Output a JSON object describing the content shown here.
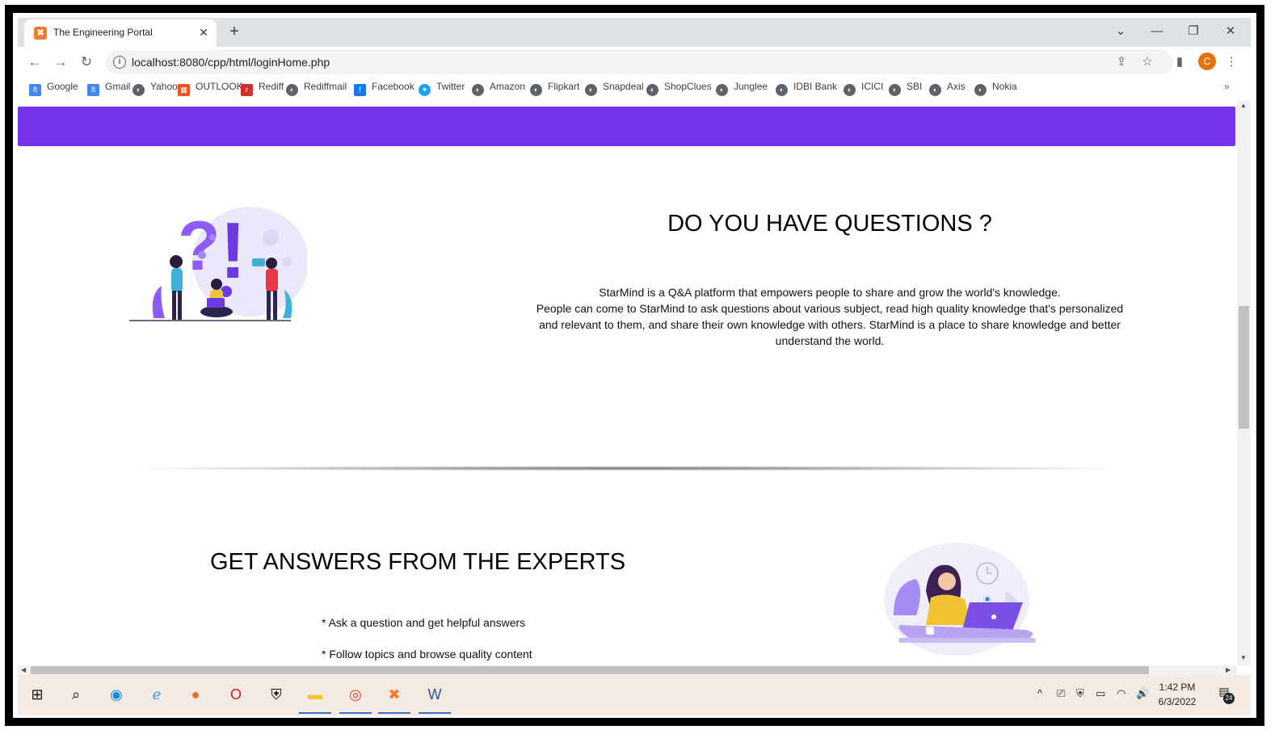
{
  "browser": {
    "tab": {
      "title": "The Engineering Portal",
      "favicon": "xampp-icon",
      "close": "✕"
    },
    "new_tab": "+",
    "window_controls": {
      "dropdown": "⌄",
      "minimize": "—",
      "restore": "❐",
      "close": "✕"
    },
    "nav": {
      "back": "←",
      "forward": "→",
      "reload": "↻"
    },
    "address": {
      "url": "localhost:8080/cpp/html/loginHome.php",
      "info": "i"
    },
    "toolbar_icons": {
      "share": "⇪",
      "star": "☆",
      "sidebar": "▮",
      "menu": "⋮"
    },
    "profile_initial": "C",
    "bookmarks": [
      {
        "label": "Google",
        "icon": "google-icon",
        "glyph": "8",
        "color": "#4285f4"
      },
      {
        "label": "Gmail",
        "icon": "gmail-icon",
        "glyph": "8",
        "color": "#4285f4"
      },
      {
        "label": "Yahoo",
        "icon": "globe-icon",
        "glyph": "◐",
        "color": "#5f6368"
      },
      {
        "label": "OUTLOOK",
        "icon": "windows-icon",
        "glyph": "▦",
        "color": "#f25022"
      },
      {
        "label": "Rediff",
        "icon": "rediff-icon",
        "glyph": "r",
        "color": "#d32f2f"
      },
      {
        "label": "Rediffmail",
        "icon": "globe-icon",
        "glyph": "◐",
        "color": "#5f6368"
      },
      {
        "label": "Facebook",
        "icon": "facebook-icon",
        "glyph": "f",
        "color": "#1877f2"
      },
      {
        "label": "Twitter",
        "icon": "twitter-icon",
        "glyph": "✦",
        "color": "#1da1f2"
      },
      {
        "label": "Amazon",
        "icon": "globe-icon",
        "glyph": "◐",
        "color": "#5f6368"
      },
      {
        "label": "Flipkart",
        "icon": "globe-icon",
        "glyph": "◐",
        "color": "#5f6368"
      },
      {
        "label": "Snapdeal",
        "icon": "globe-icon",
        "glyph": "◐",
        "color": "#5f6368"
      },
      {
        "label": "ShopClues",
        "icon": "globe-icon",
        "glyph": "◐",
        "color": "#5f6368"
      },
      {
        "label": "Junglee",
        "icon": "globe-icon",
        "glyph": "◐",
        "color": "#5f6368"
      },
      {
        "label": "IDBI Bank",
        "icon": "globe-icon",
        "glyph": "◐",
        "color": "#5f6368"
      },
      {
        "label": "ICICI",
        "icon": "globe-icon",
        "glyph": "◐",
        "color": "#5f6368"
      },
      {
        "label": "SBI",
        "icon": "globe-icon",
        "glyph": "◐",
        "color": "#5f6368"
      },
      {
        "label": "Axis",
        "icon": "globe-icon",
        "glyph": "◐",
        "color": "#5f6368"
      },
      {
        "label": "Nokia",
        "icon": "globe-icon",
        "glyph": "◐",
        "color": "#5f6368"
      }
    ],
    "bookmarks_more": "»"
  },
  "page": {
    "accent_color": "#7533ea",
    "questions": {
      "heading": "DO YOU HAVE QUESTIONS ?",
      "line1": "StarMind is a Q&A platform that empowers people to share and grow the world's knowledge.",
      "line2": "People can come to StarMind to ask questions about various subject, read high quality knowledge that's personalized and relevant to them, and share their own knowledge with others. StarMind is a place to share knowledge and better understand the world."
    },
    "experts": {
      "heading": "GET ANSWERS FROM THE EXPERTS",
      "bullets": [
        "* Ask a question and get helpful answers",
        "* Follow topics and browse quality content"
      ]
    }
  },
  "taskbar": {
    "apps": [
      {
        "name": "windows-start-icon",
        "glyph": "⊞",
        "color": "#111"
      },
      {
        "name": "search-icon",
        "glyph": "⌕",
        "color": "#111"
      },
      {
        "name": "edge-icon",
        "glyph": "◉",
        "color": "#1b8bd6"
      },
      {
        "name": "internet-explorer-icon",
        "glyph": "ℯ",
        "color": "#2b9fe0"
      },
      {
        "name": "firefox-icon",
        "glyph": "●",
        "color": "#f26a1b"
      },
      {
        "name": "opera-icon",
        "glyph": "O",
        "color": "#e0152b"
      },
      {
        "name": "security-shield-icon",
        "glyph": "⛨",
        "color": "#111"
      },
      {
        "name": "file-explorer-icon",
        "glyph": "▬",
        "color": "#f2c230"
      },
      {
        "name": "chrome-icon",
        "glyph": "◎",
        "color": "#db4437"
      },
      {
        "name": "xampp-icon",
        "glyph": "✖",
        "color": "#fb7a24"
      },
      {
        "name": "word-icon",
        "glyph": "W",
        "color": "#2b5797"
      }
    ],
    "tray": [
      "^",
      "⎚",
      "⛨",
      "▭",
      "◠",
      "🔊"
    ],
    "time": "1:42 PM",
    "date": "6/3/2022",
    "notification_count": "24"
  }
}
